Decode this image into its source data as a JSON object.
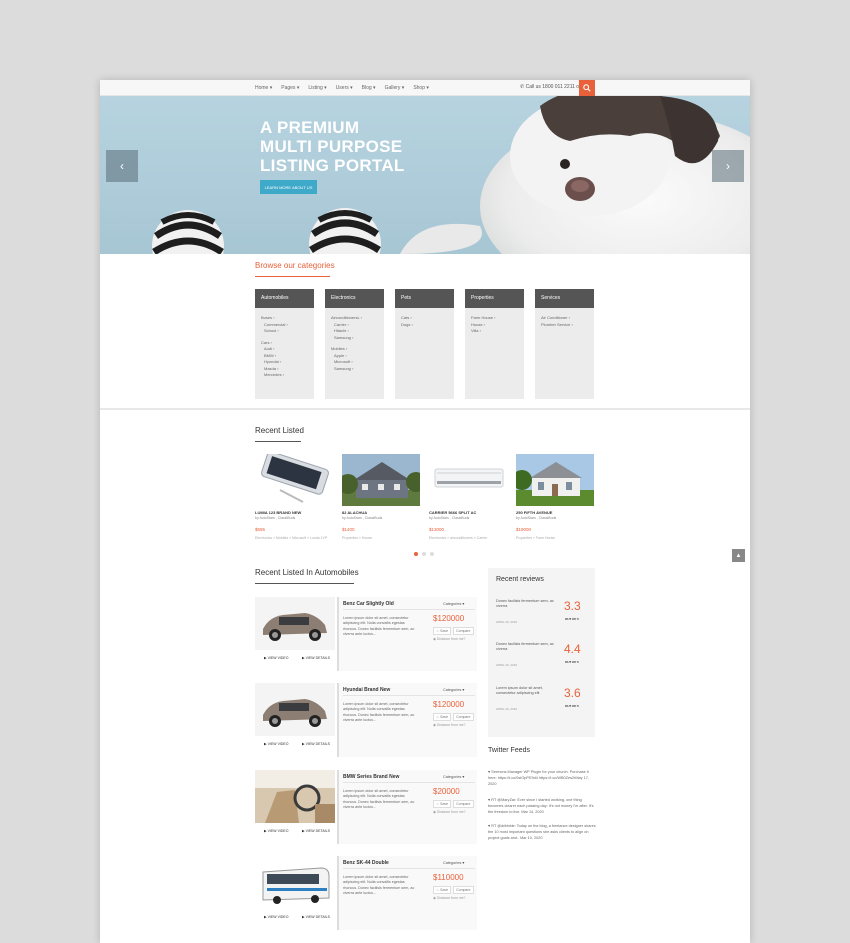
{
  "nav": {
    "menu": [
      "Home ▾",
      "Pages ▾",
      "Listing ▾",
      "Users ▾",
      "Blog ▾",
      "Gallery ▾",
      "Shop ▾"
    ],
    "phone": "Call us 1800 011 2211 or"
  },
  "hero": {
    "title_lines": [
      "A PREMIUM",
      "MULTI PURPOSE",
      "LISTING PORTAL"
    ],
    "cta": "LEARN MORE ABOUT US",
    "prev": "‹",
    "next": "›"
  },
  "categories": {
    "title": "Browse our categories",
    "items": [
      {
        "name": "Automobiles",
        "lines": [
          [
            "Buses ›",
            0,
            0
          ],
          [
            "Commercial ›",
            1,
            0
          ],
          [
            "School ›",
            1,
            0
          ],
          [
            "Cars ›",
            0,
            1
          ],
          [
            "Audi ›",
            1,
            0
          ],
          [
            "BMW ›",
            1,
            0
          ],
          [
            "Hyundai ›",
            1,
            0
          ],
          [
            "Mazda ›",
            1,
            0
          ],
          [
            "Mercedes ›",
            1,
            0
          ]
        ]
      },
      {
        "name": "Electronics",
        "lines": [
          [
            "AirconditionersL ›",
            0,
            0
          ],
          [
            "Carrier ›",
            1,
            0
          ],
          [
            "Hitachi ›",
            1,
            0
          ],
          [
            "Samsung ›",
            1,
            0
          ],
          [
            "Mobiles ›",
            0,
            1
          ],
          [
            "Apple ›",
            1,
            0
          ],
          [
            "Microsoft ›",
            1,
            0
          ],
          [
            "Samsung ›",
            1,
            0
          ]
        ]
      },
      {
        "name": "Pets",
        "lines": [
          [
            "Cats ›",
            0,
            0
          ],
          [
            "Dogs ›",
            0,
            0
          ]
        ]
      },
      {
        "name": "Properties",
        "lines": [
          [
            "Farm House ›",
            0,
            0
          ],
          [
            "House ›",
            0,
            0
          ],
          [
            "Villa ›",
            0,
            0
          ]
        ]
      },
      {
        "name": "Services",
        "lines": [
          [
            "Air Conditioner ›",
            0,
            0
          ],
          [
            "Plumber Service ›",
            0,
            0
          ]
        ]
      }
    ]
  },
  "recent": {
    "title": "Recent Listed",
    "items": [
      {
        "title": "LUMIA 123 BRAND NEW",
        "by": "by AutoStars , ClassiBuds",
        "price": "$595",
        "cats": "Electronics » Mobiles » Microsoft » Lumia 1VP"
      },
      {
        "title": "82 ALACHUA",
        "by": "by AutoStars , ClassiBuds",
        "price": "$1400",
        "cats": "Properties » House"
      },
      {
        "title": "CARRIER 5666 SPLIT AC",
        "by": "by AutoStars , ClassiBuds",
        "price": "$13000",
        "cats": "Electronics » airconditioners » Carrier"
      },
      {
        "title": "250 FIFTH AVENUE",
        "by": "by AutoStars , ClassiBuds",
        "price": "$19000",
        "cats": "Properties » Farm House"
      }
    ]
  },
  "autos": {
    "title": "Recent Listed In Automobiles",
    "video": "▶ VIEW VIDEO",
    "details": "▶ VIEW DETAILS",
    "category": "Categories ▾",
    "btn1": "☆ Save",
    "btn2": "Compare",
    "distance": "◉ Distance from me?",
    "desc": "Lorem ipsum dolor sit amet, consectetur adipiscing elit. Nulla convallis egestas rhoncus. Donec facilisis fermentum sem, ac viverra ante luctus...",
    "items": [
      {
        "title": "Benz Car Slightly Old",
        "price": "$120000"
      },
      {
        "title": "Hyundai Brand New",
        "price": "$120000"
      },
      {
        "title": "BMW Series Brand New",
        "price": "$20000"
      },
      {
        "title": "Benz SK-44 Double",
        "price": "$110000"
      }
    ]
  },
  "reviews": {
    "title": "Recent reviews",
    "items": [
      {
        "text": "Donec facilisis fermentum sem, ac viverra",
        "score": "3.3",
        "of": "OUT OF 5",
        "date": "APRIL 20, 2016"
      },
      {
        "text": "Donec facilisis fermentum sem, ac viverra",
        "score": "4.4",
        "of": "OUT OF 5",
        "date": "APRIL 20, 2016"
      },
      {
        "text": "Lorem ipsum dolor sit amet, consectetur adipiscing elit",
        "score": "3.6",
        "of": "OUT OF 5",
        "date": "APRIL 20, 2016"
      }
    ]
  },
  "twitter": {
    "title": "Twitter Feeds",
    "items": [
      "♥ Sermons Manager WP Plugin for your church. Purchase it here: https://t.co/0stOpPE9d4 https://t.co/WB0Zes2rMay 17, 2020",
      "♥ RT @MaryZar: Ever since I started working, one thing becomes clearer each passing day: It's not money I'm after. It's the freedom to live. Mar 14, 2020",
      "♥ RT @dribbble: Today on the blog, a freelance designer shares the 10 most important questions she asks clients to align on project goals and.. Mar 10, 2020"
    ]
  },
  "colors": {
    "accent": "#e8613a",
    "cta": "#3fa9c9",
    "cat_header": "#555555"
  }
}
